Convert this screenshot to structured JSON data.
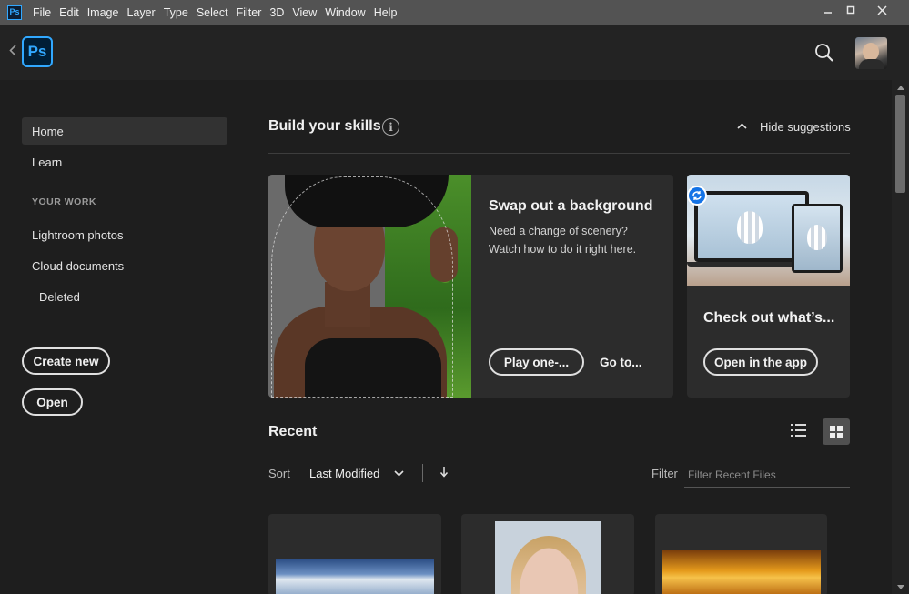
{
  "menubar": {
    "app_icon": "Ps",
    "items": [
      "File",
      "Edit",
      "Image",
      "Layer",
      "Type",
      "Select",
      "Filter",
      "3D",
      "View",
      "Window",
      "Help"
    ],
    "window_controls": [
      "minimize-icon",
      "maximize-icon",
      "close-icon"
    ]
  },
  "header": {
    "logo": "Ps",
    "icons": [
      "back-arrow-icon",
      "search-icon",
      "avatar"
    ]
  },
  "sidebar": {
    "home": "Home",
    "learn": "Learn",
    "section_label": "YOUR WORK",
    "lightroom": "Lightroom photos",
    "cloud_docs": "Cloud documents",
    "deleted": "Deleted",
    "create_new": "Create new",
    "open": "Open"
  },
  "skills": {
    "title": "Build your skills",
    "info_glyph": "i",
    "hide_label": "Hide suggestions",
    "card_main": {
      "title": "Swap out a background",
      "description": "Need a change of scenery? Watch how to do it right here.",
      "primary_button": "Play one-...",
      "secondary_link": "Go to..."
    },
    "card_new": {
      "title": "Check out what’s...",
      "button": "Open in the app"
    }
  },
  "recent": {
    "title": "Recent",
    "sort_label": "Sort",
    "sort_value": "Last Modified",
    "filter_label": "Filter",
    "filter_placeholder": "Filter Recent Files",
    "view_modes": [
      "list-view-icon",
      "grid-view-icon"
    ],
    "selected_view": "grid"
  },
  "colors": {
    "menubar": "#535353",
    "background": "#1e1e1e",
    "card": "#2c2c2c",
    "ps_blue": "#31a8ff",
    "ps_navy": "#001e36"
  }
}
